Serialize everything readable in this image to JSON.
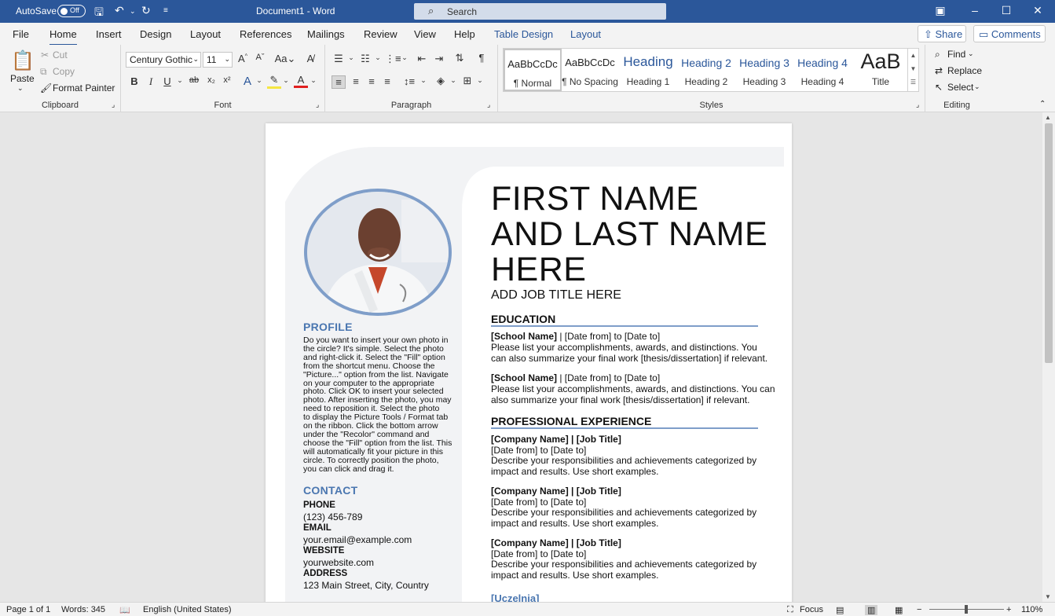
{
  "titlebar": {
    "autosave_label": "AutoSave",
    "autosave_state": "Off",
    "doc_title": "Document1 - Word",
    "search_placeholder": "Search"
  },
  "menu": {
    "tabs": [
      "File",
      "Home",
      "Insert",
      "Design",
      "Layout",
      "References",
      "Mailings",
      "Review",
      "View",
      "Help",
      "Table Design",
      "Layout"
    ],
    "active_tab": "Home",
    "share_label": "Share",
    "comments_label": "Comments"
  },
  "ribbon": {
    "clipboard": {
      "paste": "Paste",
      "cut": "Cut",
      "copy": "Copy",
      "format_painter": "Format Painter",
      "label": "Clipboard"
    },
    "font": {
      "family": "Century Gothic",
      "size": "11",
      "label": "Font"
    },
    "paragraph": {
      "label": "Paragraph"
    },
    "styles": {
      "label": "Styles",
      "items": [
        {
          "preview": "AaBbCcDc",
          "name": "¶ Normal"
        },
        {
          "preview": "AaBbCcDc",
          "name": "¶ No Spacing"
        },
        {
          "preview": "Heading",
          "name": "Heading 1"
        },
        {
          "preview": "Heading 2",
          "name": "Heading 2"
        },
        {
          "preview": "Heading 3",
          "name": "Heading 3"
        },
        {
          "preview": "Heading 4",
          "name": "Heading 4"
        },
        {
          "preview": "AaB",
          "name": "Title"
        }
      ]
    },
    "editing": {
      "find": "Find",
      "replace": "Replace",
      "select": "Select",
      "label": "Editing"
    }
  },
  "resume": {
    "name": "FIRST NAME AND LAST NAME HERE",
    "job_title": "ADD JOB TITLE HERE",
    "profile_title": "PROFILE",
    "profile_lines": [
      "Do you want to insert your own photo in",
      "the circle? It's simple. Select the photo",
      "and right-click it. Select the \"Fill\" option",
      "from the shortcut menu. Choose the",
      "\"Picture...\" option from the list. Navigate",
      "on your computer to the appropriate",
      "photo. Click OK to insert your selected",
      "photo. After inserting the photo, you may",
      "need to reposition it. Select the photo",
      "to display the Picture Tools / Format tab",
      "on the ribbon. Click the bottom arrow",
      "under the \"Recolor\" command and",
      "choose the \"Fill\" option from the list. This",
      "will automatically fit your picture in this",
      "circle. To correctly position the photo,",
      "you can click and drag it."
    ],
    "contact_title": "CONTACT",
    "contact": [
      {
        "label": "PHONE",
        "value": "(123) 456-789"
      },
      {
        "label": "EMAIL",
        "value": "your.email@example.com"
      },
      {
        "label": "WEBSITE",
        "value": "yourwebsite.com"
      },
      {
        "label": "ADDRESS",
        "value": "123 Main Street, City, Country"
      }
    ],
    "education_title": "EDUCATION",
    "education": [
      {
        "school": "[School Name]",
        "dates": "| [Date from] to [Date to]",
        "line1": "Please list your accomplishments, awards, and distinctions. You",
        "line2": "can also summarize your final work [thesis/dissertation] if relevant."
      },
      {
        "school": "[School Name]",
        "dates": "| [Date from] to [Date to]",
        "line1": "Please list your accomplishments, awards, and distinctions. You can",
        "line2": "also summarize your final work [thesis/dissertation] if relevant."
      }
    ],
    "experience_title": "PROFESSIONAL EXPERIENCE",
    "experience": [
      {
        "head": "[Company Name] | [Job Title]",
        "dates": "[Date from] to [Date to]",
        "line1": "Describe your responsibilities and achievements categorized by",
        "line2": "impact and results. Use short examples."
      },
      {
        "head": "[Company Name] | [Job Title]",
        "dates": "[Date from] to [Date to]",
        "line1": "Describe your responsibilities and achievements categorized by",
        "line2": "impact and results. Use short examples."
      },
      {
        "head": "[Company Name] | [Job Title]",
        "dates": "[Date from] to [Date to]",
        "line1": "Describe your responsibilities and achievements categorized by",
        "line2": "impact and results. Use short examples."
      }
    ],
    "cutoff_heading": "[Uczelnia]"
  },
  "status": {
    "page": "Page 1 of 1",
    "words": "Words: 345",
    "language": "English (United States)",
    "focus": "Focus",
    "zoom": "110%"
  },
  "colors": {
    "accent": "#2b579a",
    "resume_blue": "#4a76b0",
    "photo_ring": "#7f9ec9"
  }
}
